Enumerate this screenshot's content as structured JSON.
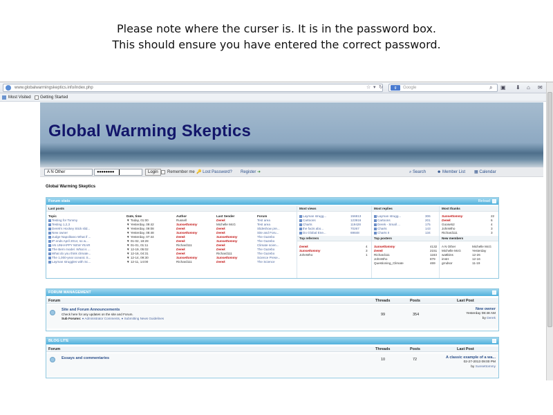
{
  "caption": {
    "line1": "Please note where the curser is. It is in the password box.",
    "line2": "This should ensure you have entered the correct password."
  },
  "browser": {
    "url": "www.globalwarmingskeptics.info/index.php",
    "search_placeholder": "Google",
    "search_engine": "g",
    "bookmarks": {
      "most_visited": "Most Visited",
      "getting_started": "Getting Started"
    }
  },
  "site": {
    "title": "Global Warming Skeptics",
    "heading": "Global Warming Skeptics"
  },
  "login": {
    "username": "A N Other",
    "password": "●●●●●●●●",
    "login_button": "Login",
    "remember": "Remember me",
    "lost_password": "Lost Password?",
    "register": "Register",
    "search": "Search",
    "member_list": "Member List",
    "calendar": "Calendar"
  },
  "forum_stats": {
    "title": "Forum stats",
    "reload": "Reload",
    "last_posts_label": "Last posts",
    "columns": {
      "topic": "Topic",
      "date": "Date, time",
      "author": "Author",
      "last_sender": "Last Sender",
      "forum": "Forum"
    },
    "rows": [
      {
        "topic": "Testing for Tommy",
        "date": "Today, 01:00",
        "author": "Russell",
        "sender": "Derek",
        "forum": "Test area",
        "author_red": false,
        "sender_red": true
      },
      {
        "topic": "Testing 1,2,3",
        "date": "Yesterday, 09:42",
        "author": "Sunsettommy",
        "sender": "Michelle McG",
        "forum": "Test area",
        "author_red": true,
        "sender_red": false
      },
      {
        "topic": "Derek's Hockey Stick slid...",
        "date": "Yesterday, 09:08",
        "author": "Derek",
        "sender": "Derek",
        "forum": "Slideshow pre...",
        "author_red": true,
        "sender_red": true
      },
      {
        "topic": "New owner",
        "date": "Yesterday, 08:48",
        "author": "Sunsettommy",
        "sender": "Derek",
        "forum": "Site and Foru...",
        "author_red": true,
        "sender_red": true
      },
      {
        "topic": "Judge Napolitano What if ...",
        "date": "Yesterday, 07:44",
        "author": "Derek",
        "sender": "Sunsettommy",
        "forum": "The Gazebo",
        "author_red": true,
        "sender_red": true
      },
      {
        "topic": "IP ends April 2014, so w...",
        "date": "01-02, 18:28",
        "author": "Derek",
        "sender": "Sunsettommy",
        "forum": "The Gazebo",
        "author_red": true,
        "sender_red": true
      },
      {
        "topic": "AN UNHAPPY NEW YEAR",
        "date": "01-01, 01:11",
        "author": "Richard111",
        "sender": "Derek",
        "forum": "Climate scien...",
        "author_red": false,
        "sender_red": true
      },
      {
        "topic": "The Bern model. What is ...",
        "date": "12-19, 05:02",
        "author": "Derek",
        "sender": "Derek",
        "forum": "The Gazebo",
        "author_red": true,
        "sender_red": true
      },
      {
        "topic": "What do you think climate...",
        "date": "12-16, 04:31",
        "author": "Derek",
        "sender": "Richard111",
        "forum": "The Gazebo",
        "author_red": true,
        "sender_red": false
      },
      {
        "topic": "The 1,000-year oceanic S...",
        "date": "12-14, 09:30",
        "author": "Sunsettommy",
        "sender": "Sunsettommy",
        "forum": "Science Prese...",
        "author_red": true,
        "sender_red": true
      },
      {
        "topic": "Layman struggles with Sc...",
        "date": "12-11, 14:00",
        "author": "Richard111",
        "sender": "Derek",
        "forum": "The Science",
        "author_red": false,
        "sender_red": true
      }
    ],
    "most_views_label": "Most views",
    "most_views": [
      {
        "name": "Layman strugg...",
        "count": "156813"
      },
      {
        "name": "Cartoons",
        "count": "123916"
      },
      {
        "name": "Charts",
        "count": "119428"
      },
      {
        "name": "the facts abo...",
        "count": "70267"
      },
      {
        "name": "Do Global Ene...",
        "count": "69848"
      }
    ],
    "top_referrers_label": "Top referrers",
    "top_referrers": [
      {
        "name": "Derek",
        "count": "4",
        "red": true
      },
      {
        "name": "Sunsettommy",
        "count": "3",
        "red": true
      },
      {
        "name": "JohnWho",
        "count": "1",
        "red": false
      }
    ],
    "most_replies_label": "Most replies",
    "most_replies": [
      {
        "name": "Layman strugg...",
        "count": "306"
      },
      {
        "name": "Cartoons",
        "count": "201"
      },
      {
        "name": "Derek - Small ...",
        "count": "175"
      },
      {
        "name": "Charts",
        "count": "143"
      },
      {
        "name": "Charts II",
        "count": "134"
      }
    ],
    "top_posters_label": "Top posters",
    "top_posters": [
      {
        "name": "Sunsettommy",
        "count": "4132",
        "red": true
      },
      {
        "name": "Derek",
        "count": "2151",
        "red": true
      },
      {
        "name": "Richard111",
        "count": "1163",
        "red": false
      },
      {
        "name": "JohnWho",
        "count": "879",
        "red": false
      },
      {
        "name": "Questioning_Climate",
        "count": "469",
        "red": false
      }
    ],
    "most_thanks_label": "Most thanks",
    "most_thanks": [
      {
        "name": "Sunsettommy",
        "count": "22",
        "red": true
      },
      {
        "name": "Derek",
        "count": "6",
        "red": true
      },
      {
        "name": "Goose52",
        "count": "4",
        "red": false
      },
      {
        "name": "JohnWho",
        "count": "3",
        "red": false
      },
      {
        "name": "Richard111",
        "count": "3",
        "red": false
      }
    ],
    "new_members_label": "New members",
    "new_members": [
      {
        "name": "A N Other",
        "date": "Michelle McG"
      },
      {
        "name": "Michelle McG",
        "date": "Yesterday"
      },
      {
        "name": "wattbins",
        "date": "12-26"
      },
      {
        "name": "imsH",
        "date": "12-16"
      },
      {
        "name": "grndsor",
        "date": "11-19"
      }
    ]
  },
  "forum_management": {
    "title": "FORUM MANAGEMENT",
    "col_forum": "Forum",
    "col_threads": "Threads",
    "col_posts": "Posts",
    "col_last": "Last Post",
    "forum_name": "Site and Forum Announcements",
    "forum_desc": "Check here for any updates on the site and Forum.",
    "sub_label": "Sub Forums:",
    "sub1": "Administrator Comments,",
    "sub2": "Submitting News Guidelines",
    "threads": "99",
    "posts": "354",
    "last_title": "New owner",
    "last_date": "Yesterday 08:48 AM",
    "last_by": "by",
    "last_user": "Derek"
  },
  "blog_lite": {
    "title": "BLOG LITE",
    "col_forum": "Forum",
    "col_threads": "Threads",
    "col_posts": "Posts",
    "col_last": "Last Post",
    "forum_name": "Essays and commentaries",
    "threads": "10",
    "posts": "72",
    "last_title": "A classic example of a wa...",
    "last_date": "02-27-2013 09:00 PM",
    "last_by": "by",
    "last_user": "Sunsettommy"
  }
}
